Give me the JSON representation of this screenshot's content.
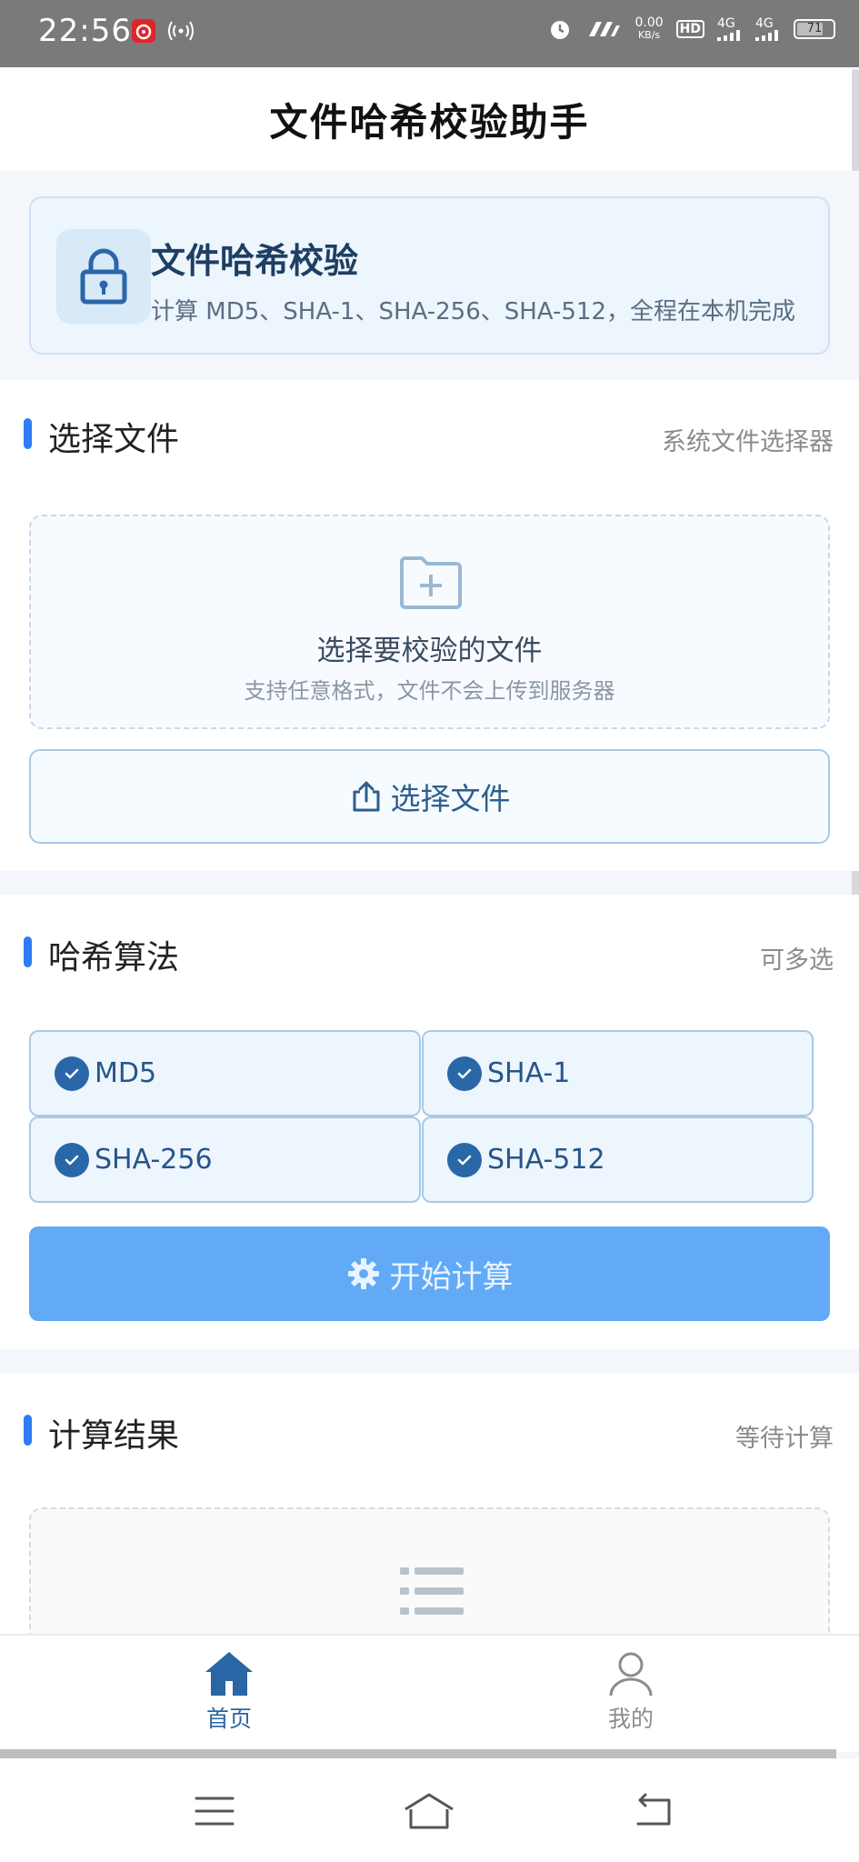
{
  "status_bar": {
    "time": "22:56",
    "speed_value": "0.00",
    "speed_unit": "KB/s",
    "network_1": "4G",
    "network_2": "4G",
    "battery": "71",
    "hd_label": "HD"
  },
  "header": {
    "title": "文件哈希校验助手"
  },
  "hero": {
    "title": "文件哈希校验",
    "subtitle": "计算 MD5、SHA-1、SHA-256、SHA-512，全程在本机完成",
    "icon": "lock-icon"
  },
  "select_section": {
    "title": "选择文件",
    "meta": "系统文件选择器",
    "dropzone_title": "选择要校验的文件",
    "dropzone_subtitle": "支持任意格式，文件不会上传到服务器",
    "button_label": "选择文件"
  },
  "algo_section": {
    "title": "哈希算法",
    "meta": "可多选",
    "options": [
      {
        "label": "MD5",
        "checked": true
      },
      {
        "label": "SHA-1",
        "checked": true
      },
      {
        "label": "SHA-256",
        "checked": true
      },
      {
        "label": "SHA-512",
        "checked": true
      }
    ],
    "start_label": "开始计算"
  },
  "result_section": {
    "title": "计算结果",
    "meta": "等待计算"
  },
  "bottom_nav": {
    "home_label": "首页",
    "me_label": "我的"
  },
  "colors": {
    "accent": "#2f7cf6",
    "primary_dark": "#2a65a6",
    "start_button": "#62aaf6"
  }
}
